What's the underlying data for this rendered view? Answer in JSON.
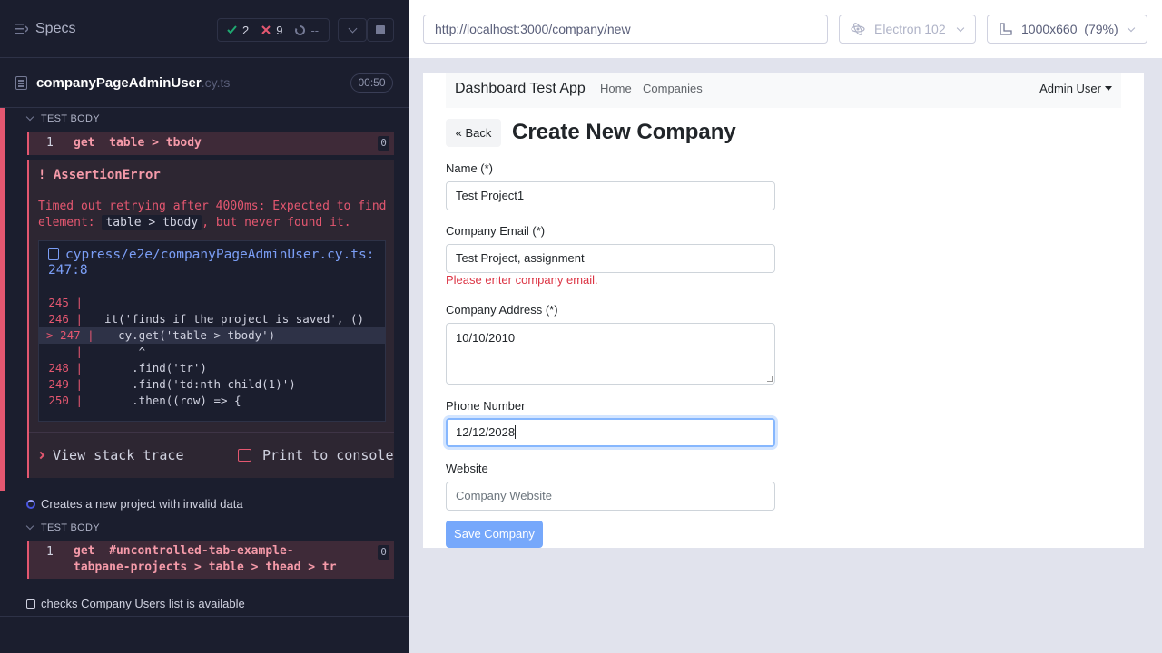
{
  "reporter": {
    "title": "Specs",
    "stats": {
      "passed": "2",
      "failed": "9",
      "pending": "--"
    },
    "spec": {
      "name": "companyPageAdminUser",
      "ext": ".cy.ts",
      "duration": "00:50"
    },
    "section1": {
      "heading": "TEST BODY",
      "command": {
        "num": "1",
        "name": "get",
        "selector": "table > tbody",
        "count": "0"
      }
    },
    "error": {
      "title": "! AssertionError",
      "message_before": "Timed out retrying after 4000ms: Expected to find element: ",
      "message_code": "table > tbody",
      "message_after": ", but never found it.",
      "file": "cypress/e2e/companyPageAdminUser.cy.ts:247:8",
      "code_lines": [
        {
          "ln": "245 |",
          "txt": ""
        },
        {
          "ln": "246 |",
          "txt": "  it('finds if the project is saved', ()"
        },
        {
          "ln": "> 247 |",
          "txt": "    cy.get('table > tbody')"
        },
        {
          "ln": "|",
          "txt": "       ^"
        },
        {
          "ln": "248 |",
          "txt": "      .find('tr')"
        },
        {
          "ln": "249 |",
          "txt": "      .find('td:nth-child(1)')"
        },
        {
          "ln": "250 |",
          "txt": "      .then((row) => {"
        }
      ],
      "stack_label": "View stack trace",
      "console_label": "Print to console"
    },
    "test2": {
      "label": "Creates a new project with invalid data"
    },
    "section2": {
      "heading": "TEST BODY",
      "command": {
        "num": "1",
        "name": "get",
        "selector": "#uncontrolled-tab-example-tabpane-projects > table > thead > tr",
        "count": "0"
      }
    },
    "test3": {
      "label": "checks Company Users list is available"
    }
  },
  "browser": {
    "url": "http://localhost:3000/company/new",
    "browser_name": "Electron 102",
    "viewport": "1000x660  (79%)"
  },
  "app": {
    "brand": "Dashboard Test App",
    "nav": [
      "Home",
      "Companies"
    ],
    "user": "Admin User",
    "back": "« Back",
    "title": "Create New Company",
    "fields": {
      "name": {
        "label": "Name (*)",
        "value": "Test Project1"
      },
      "email": {
        "label": "Company Email (*)",
        "value": "Test Project, assignment",
        "error": "Please enter company email."
      },
      "address": {
        "label": "Company Address (*)",
        "value": "10/10/2010"
      },
      "phone": {
        "label": "Phone Number",
        "value": "12/12/2028"
      },
      "website": {
        "label": "Website",
        "placeholder": "Company Website"
      }
    },
    "save": "Save Company"
  },
  "colors": {
    "fail": "#e45770",
    "pass": "#1fa971",
    "link": "#7b9ef6",
    "primary_disabled": "#76a8fb",
    "invalid": "#dc3545"
  }
}
